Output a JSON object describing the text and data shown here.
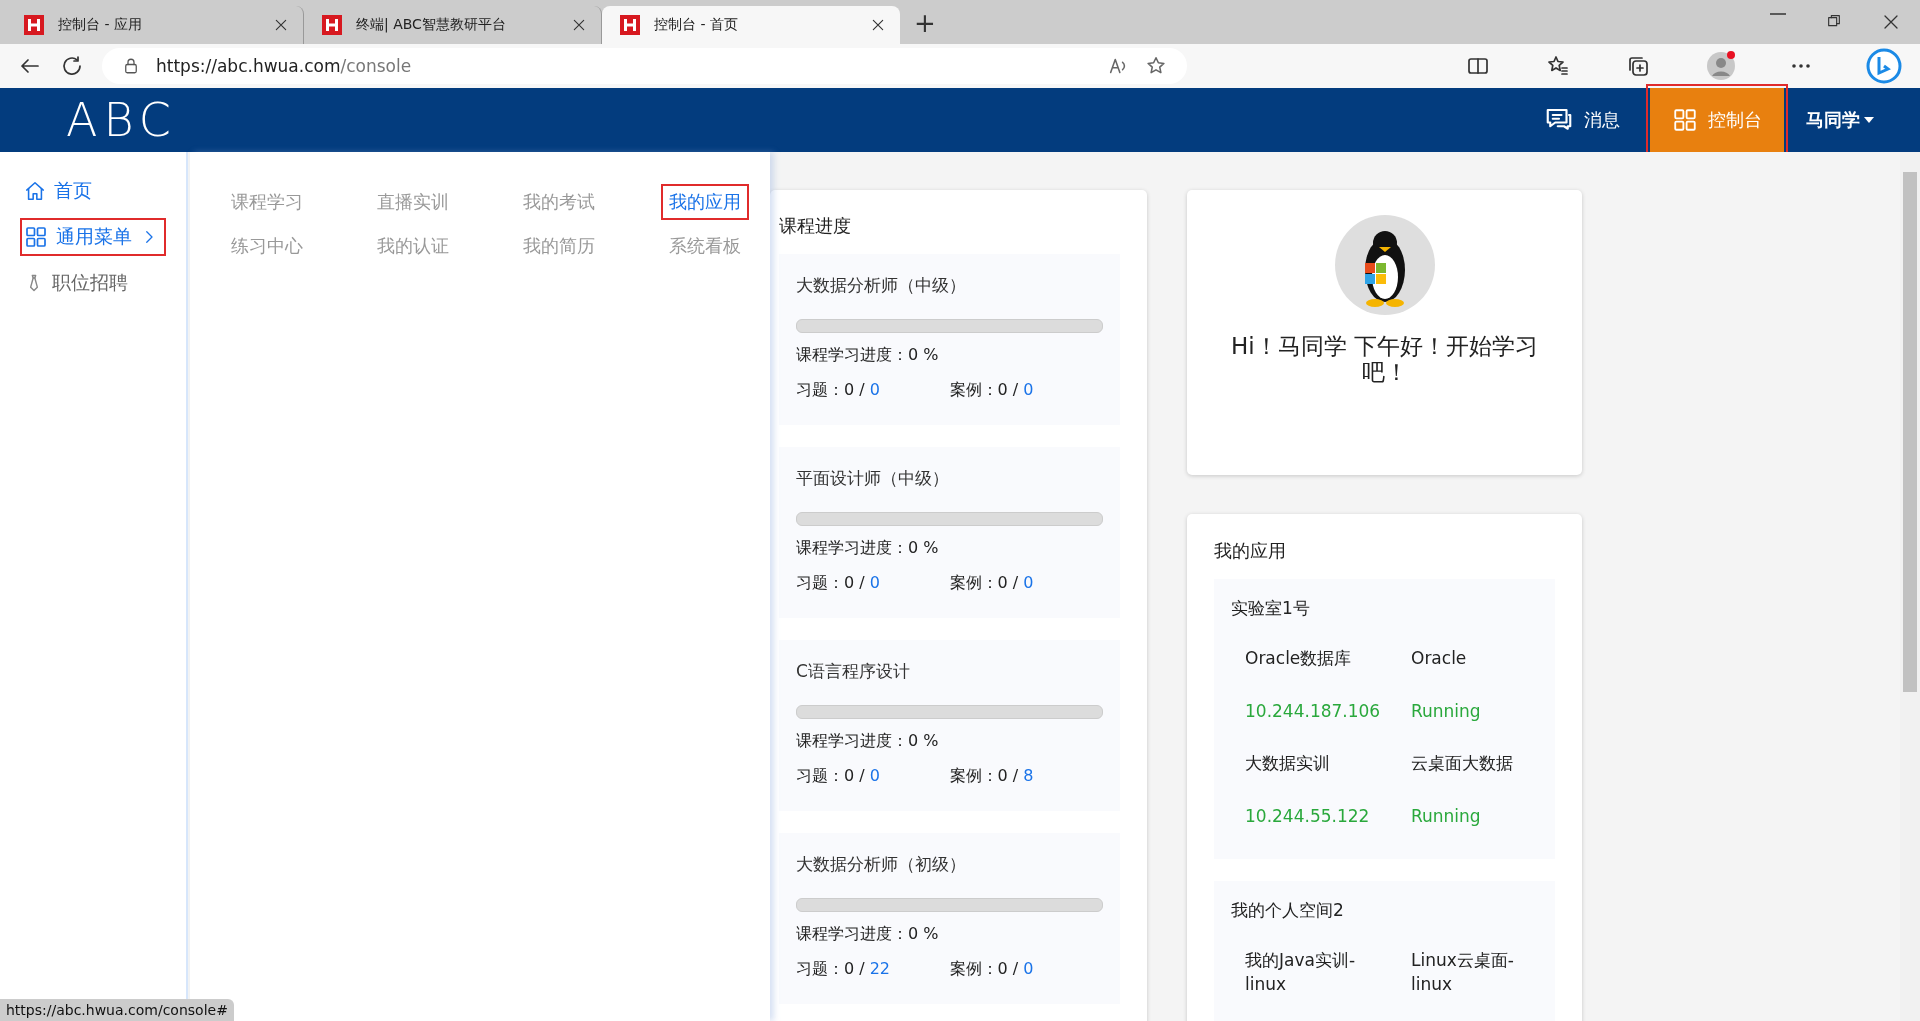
{
  "browser": {
    "tabs": [
      {
        "title": "控制台 - 应用",
        "selected": false
      },
      {
        "title": "终端| ABC智慧教研平台",
        "selected": false
      },
      {
        "title": "控制台 - 首页",
        "selected": true
      }
    ],
    "new_tab": "+",
    "url_host": "https://abc.hwua.com",
    "url_path": "/console",
    "status_url": "https://abc.hwua.com/console#"
  },
  "header": {
    "logo": "ABC",
    "nav": [
      {
        "label": "消息",
        "selected": false
      },
      {
        "label": "控制台",
        "selected": true
      }
    ],
    "user": "马同学"
  },
  "sidebar": {
    "items": [
      {
        "label": "首页",
        "selected": false
      },
      {
        "label": "通用菜单",
        "selected": true
      },
      {
        "label": "职位招聘",
        "selected": false
      }
    ]
  },
  "menu": {
    "items": [
      {
        "label": "课程学习",
        "selected": false
      },
      {
        "label": "直播实训",
        "selected": false
      },
      {
        "label": "我的考试",
        "selected": false
      },
      {
        "label": "我的应用",
        "selected": true
      },
      {
        "label": "练习中心",
        "selected": false
      },
      {
        "label": "我的认证",
        "selected": false
      },
      {
        "label": "我的简历",
        "selected": false
      },
      {
        "label": "系统看板",
        "selected": false
      }
    ]
  },
  "progress": {
    "title": "课程进度",
    "courses": [
      {
        "title": "大数据分析师（中级）",
        "level": 0,
        "progress": "课程学习进度：0 %",
        "exercises": "习题：0 /",
        "exercises_total": "0",
        "cases": "案例：0 /",
        "cases_total": "0"
      },
      {
        "title": "平面设计师（中级）",
        "level": 0,
        "progress": "课程学习进度：0 %",
        "exercises": "习题：0 /",
        "exercises_total": "0",
        "cases": "案例：0 /",
        "cases_total": "0"
      },
      {
        "title": "C语言程序设计",
        "level": 0,
        "progress": "课程学习进度：0 %",
        "exercises": "习题：0 /",
        "exercises_total": "0",
        "cases": "案例：0 /",
        "cases_total": "8"
      },
      {
        "title": "大数据分析师（初级）",
        "level": 0,
        "progress": "课程学习进度：0 %",
        "exercises": "习题：0 /",
        "exercises_total": "22",
        "cases": "案例：0 /",
        "cases_total": "0"
      }
    ]
  },
  "greeting": "Hi！马同学 下午好！开始学习吧！",
  "apps": {
    "title": "我的应用",
    "groups": [
      {
        "title": "实验室1号",
        "apps": [
          {
            "name": "Oracle数据库",
            "type": "Oracle",
            "ip": "10.244.187.106",
            "status": "Running"
          },
          {
            "name": "大数据实训",
            "type": "云桌面大数据",
            "ip": "10.244.55.122",
            "status": "Running"
          }
        ]
      },
      {
        "title": "我的个人空间2",
        "apps": [
          {
            "name": "我的Java实训-linux",
            "type": "Linux云桌面-linux"
          }
        ]
      }
    ]
  }
}
